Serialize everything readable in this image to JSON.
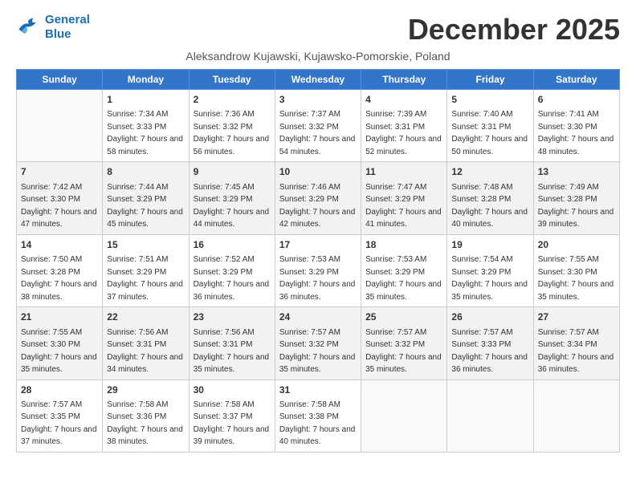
{
  "logo": {
    "line1": "General",
    "line2": "Blue"
  },
  "title": "December 2025",
  "subtitle": "Aleksandrow Kujawski, Kujawsko-Pomorskie, Poland",
  "days_of_week": [
    "Sunday",
    "Monday",
    "Tuesday",
    "Wednesday",
    "Thursday",
    "Friday",
    "Saturday"
  ],
  "weeks": [
    [
      {
        "num": "",
        "sunrise": "",
        "sunset": "",
        "daylight": ""
      },
      {
        "num": "1",
        "sunrise": "Sunrise: 7:34 AM",
        "sunset": "Sunset: 3:33 PM",
        "daylight": "Daylight: 7 hours and 58 minutes."
      },
      {
        "num": "2",
        "sunrise": "Sunrise: 7:36 AM",
        "sunset": "Sunset: 3:32 PM",
        "daylight": "Daylight: 7 hours and 56 minutes."
      },
      {
        "num": "3",
        "sunrise": "Sunrise: 7:37 AM",
        "sunset": "Sunset: 3:32 PM",
        "daylight": "Daylight: 7 hours and 54 minutes."
      },
      {
        "num": "4",
        "sunrise": "Sunrise: 7:39 AM",
        "sunset": "Sunset: 3:31 PM",
        "daylight": "Daylight: 7 hours and 52 minutes."
      },
      {
        "num": "5",
        "sunrise": "Sunrise: 7:40 AM",
        "sunset": "Sunset: 3:31 PM",
        "daylight": "Daylight: 7 hours and 50 minutes."
      },
      {
        "num": "6",
        "sunrise": "Sunrise: 7:41 AM",
        "sunset": "Sunset: 3:30 PM",
        "daylight": "Daylight: 7 hours and 48 minutes."
      }
    ],
    [
      {
        "num": "7",
        "sunrise": "Sunrise: 7:42 AM",
        "sunset": "Sunset: 3:30 PM",
        "daylight": "Daylight: 7 hours and 47 minutes."
      },
      {
        "num": "8",
        "sunrise": "Sunrise: 7:44 AM",
        "sunset": "Sunset: 3:29 PM",
        "daylight": "Daylight: 7 hours and 45 minutes."
      },
      {
        "num": "9",
        "sunrise": "Sunrise: 7:45 AM",
        "sunset": "Sunset: 3:29 PM",
        "daylight": "Daylight: 7 hours and 44 minutes."
      },
      {
        "num": "10",
        "sunrise": "Sunrise: 7:46 AM",
        "sunset": "Sunset: 3:29 PM",
        "daylight": "Daylight: 7 hours and 42 minutes."
      },
      {
        "num": "11",
        "sunrise": "Sunrise: 7:47 AM",
        "sunset": "Sunset: 3:29 PM",
        "daylight": "Daylight: 7 hours and 41 minutes."
      },
      {
        "num": "12",
        "sunrise": "Sunrise: 7:48 AM",
        "sunset": "Sunset: 3:28 PM",
        "daylight": "Daylight: 7 hours and 40 minutes."
      },
      {
        "num": "13",
        "sunrise": "Sunrise: 7:49 AM",
        "sunset": "Sunset: 3:28 PM",
        "daylight": "Daylight: 7 hours and 39 minutes."
      }
    ],
    [
      {
        "num": "14",
        "sunrise": "Sunrise: 7:50 AM",
        "sunset": "Sunset: 3:28 PM",
        "daylight": "Daylight: 7 hours and 38 minutes."
      },
      {
        "num": "15",
        "sunrise": "Sunrise: 7:51 AM",
        "sunset": "Sunset: 3:29 PM",
        "daylight": "Daylight: 7 hours and 37 minutes."
      },
      {
        "num": "16",
        "sunrise": "Sunrise: 7:52 AM",
        "sunset": "Sunset: 3:29 PM",
        "daylight": "Daylight: 7 hours and 36 minutes."
      },
      {
        "num": "17",
        "sunrise": "Sunrise: 7:53 AM",
        "sunset": "Sunset: 3:29 PM",
        "daylight": "Daylight: 7 hours and 36 minutes."
      },
      {
        "num": "18",
        "sunrise": "Sunrise: 7:53 AM",
        "sunset": "Sunset: 3:29 PM",
        "daylight": "Daylight: 7 hours and 35 minutes."
      },
      {
        "num": "19",
        "sunrise": "Sunrise: 7:54 AM",
        "sunset": "Sunset: 3:29 PM",
        "daylight": "Daylight: 7 hours and 35 minutes."
      },
      {
        "num": "20",
        "sunrise": "Sunrise: 7:55 AM",
        "sunset": "Sunset: 3:30 PM",
        "daylight": "Daylight: 7 hours and 35 minutes."
      }
    ],
    [
      {
        "num": "21",
        "sunrise": "Sunrise: 7:55 AM",
        "sunset": "Sunset: 3:30 PM",
        "daylight": "Daylight: 7 hours and 35 minutes."
      },
      {
        "num": "22",
        "sunrise": "Sunrise: 7:56 AM",
        "sunset": "Sunset: 3:31 PM",
        "daylight": "Daylight: 7 hours and 34 minutes."
      },
      {
        "num": "23",
        "sunrise": "Sunrise: 7:56 AM",
        "sunset": "Sunset: 3:31 PM",
        "daylight": "Daylight: 7 hours and 35 minutes."
      },
      {
        "num": "24",
        "sunrise": "Sunrise: 7:57 AM",
        "sunset": "Sunset: 3:32 PM",
        "daylight": "Daylight: 7 hours and 35 minutes."
      },
      {
        "num": "25",
        "sunrise": "Sunrise: 7:57 AM",
        "sunset": "Sunset: 3:32 PM",
        "daylight": "Daylight: 7 hours and 35 minutes."
      },
      {
        "num": "26",
        "sunrise": "Sunrise: 7:57 AM",
        "sunset": "Sunset: 3:33 PM",
        "daylight": "Daylight: 7 hours and 36 minutes."
      },
      {
        "num": "27",
        "sunrise": "Sunrise: 7:57 AM",
        "sunset": "Sunset: 3:34 PM",
        "daylight": "Daylight: 7 hours and 36 minutes."
      }
    ],
    [
      {
        "num": "28",
        "sunrise": "Sunrise: 7:57 AM",
        "sunset": "Sunset: 3:35 PM",
        "daylight": "Daylight: 7 hours and 37 minutes."
      },
      {
        "num": "29",
        "sunrise": "Sunrise: 7:58 AM",
        "sunset": "Sunset: 3:36 PM",
        "daylight": "Daylight: 7 hours and 38 minutes."
      },
      {
        "num": "30",
        "sunrise": "Sunrise: 7:58 AM",
        "sunset": "Sunset: 3:37 PM",
        "daylight": "Daylight: 7 hours and 39 minutes."
      },
      {
        "num": "31",
        "sunrise": "Sunrise: 7:58 AM",
        "sunset": "Sunset: 3:38 PM",
        "daylight": "Daylight: 7 hours and 40 minutes."
      },
      {
        "num": "",
        "sunrise": "",
        "sunset": "",
        "daylight": ""
      },
      {
        "num": "",
        "sunrise": "",
        "sunset": "",
        "daylight": ""
      },
      {
        "num": "",
        "sunrise": "",
        "sunset": "",
        "daylight": ""
      }
    ]
  ]
}
